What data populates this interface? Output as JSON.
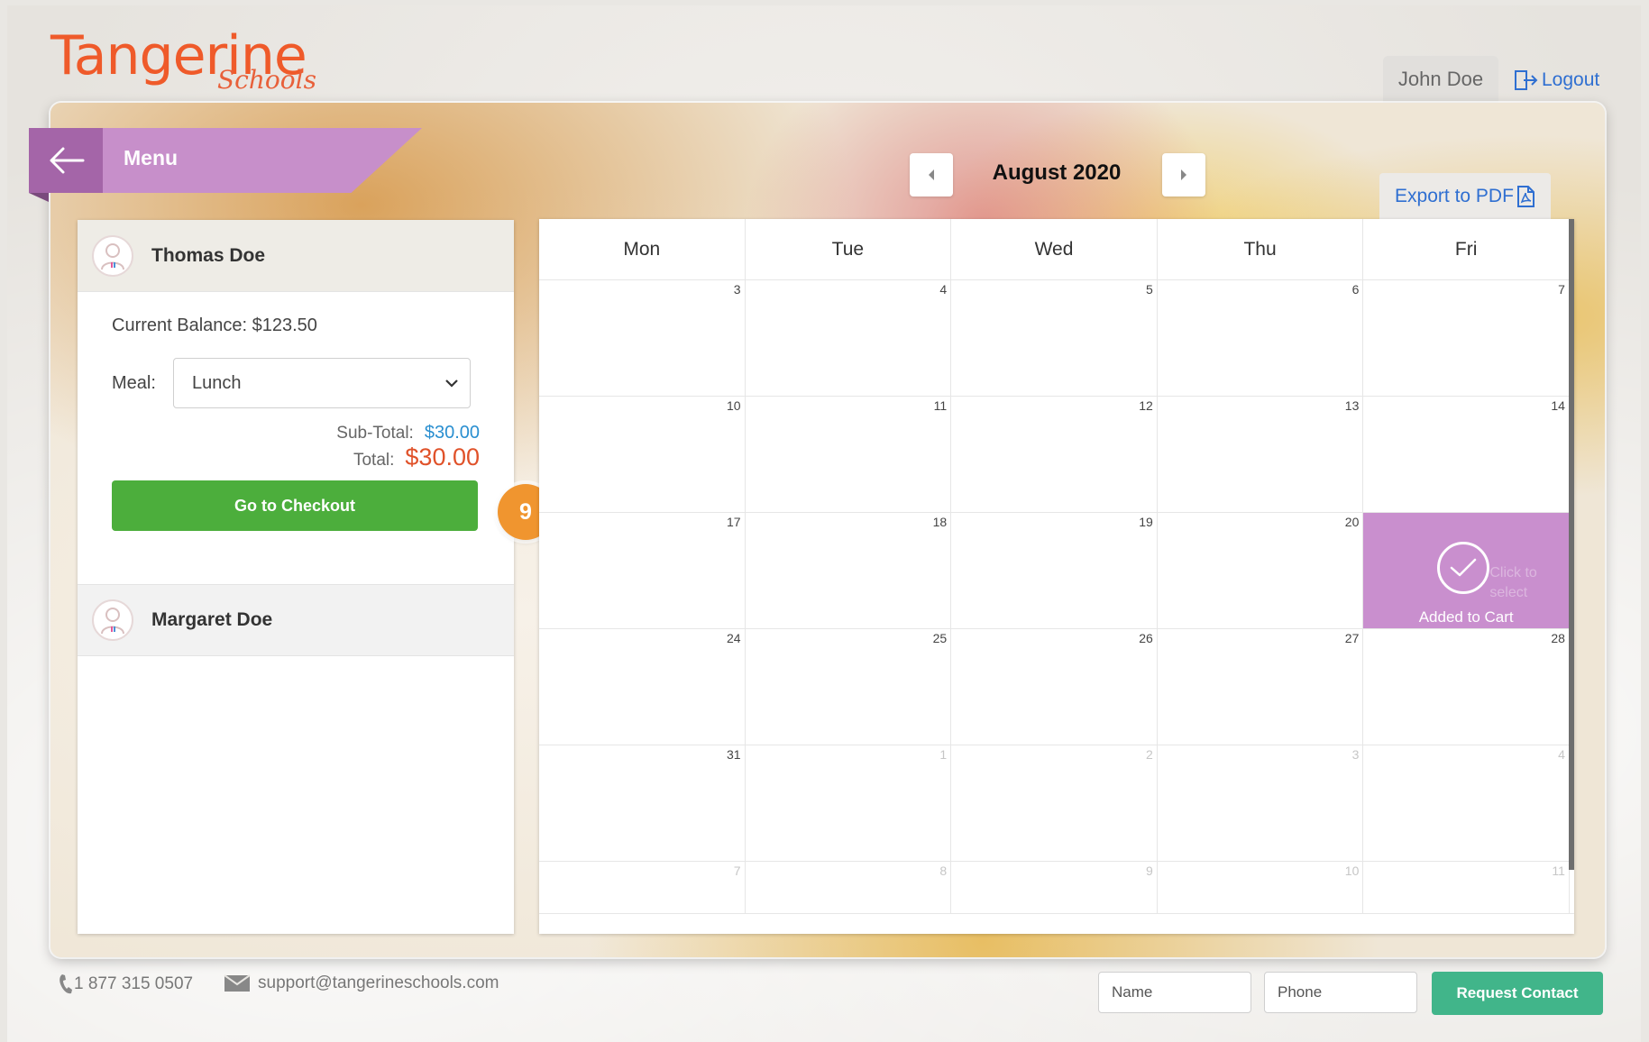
{
  "brand": {
    "name": "Tangerine",
    "sub": "Schools"
  },
  "header": {
    "user_name": "John Doe",
    "logout_label": "Logout"
  },
  "menu": {
    "label": "Menu"
  },
  "calendar": {
    "month_label": "August 2020",
    "export_label": "Export to PDF",
    "weekdays": [
      "Mon",
      "Tue",
      "Wed",
      "Thu",
      "Fri"
    ],
    "weeks": [
      [
        "3",
        "4",
        "5",
        "6",
        "7"
      ],
      [
        "10",
        "11",
        "12",
        "13",
        "14"
      ],
      [
        "17",
        "18",
        "19",
        "20",
        ""
      ],
      [
        "24",
        "25",
        "26",
        "27",
        "28"
      ],
      [
        "31",
        "1",
        "2",
        "3",
        "4"
      ],
      [
        "7",
        "8",
        "9",
        "10",
        "11"
      ]
    ],
    "added_cell": {
      "label": "Added to Cart",
      "ghost": "Click to select"
    }
  },
  "students": [
    {
      "name": "Thomas Doe",
      "balance": "Current Balance: $123.50",
      "meal_label": "Meal:",
      "meal_value": "Lunch",
      "subtotal_label": "Sub-Total:",
      "subtotal_value": "$30.00",
      "total_label": "Total:",
      "total_value": "$30.00",
      "checkout_label": "Go to Checkout"
    },
    {
      "name": "Margaret Doe"
    }
  ],
  "step_badge": "9",
  "footer": {
    "phone": "1 877 315 0507",
    "email": "support@tangerineschools.com",
    "name_placeholder": "Name",
    "phone_placeholder": "Phone",
    "request_label": "Request Contact"
  },
  "colors": {
    "brand_orange": "#ef5a2a",
    "menu_purple": "#c78fca",
    "checkout_green": "#4cae3c",
    "request_green": "#41b58a",
    "link_blue": "#2f6fd1",
    "badge_orange": "#f0952f"
  },
  "icons": [
    "arrow-left-icon",
    "caret-left-icon",
    "caret-right-icon",
    "pdf-icon",
    "logout-icon",
    "user-avatar-icon",
    "chevron-down-icon",
    "check-icon",
    "phone-icon",
    "mail-icon"
  ]
}
